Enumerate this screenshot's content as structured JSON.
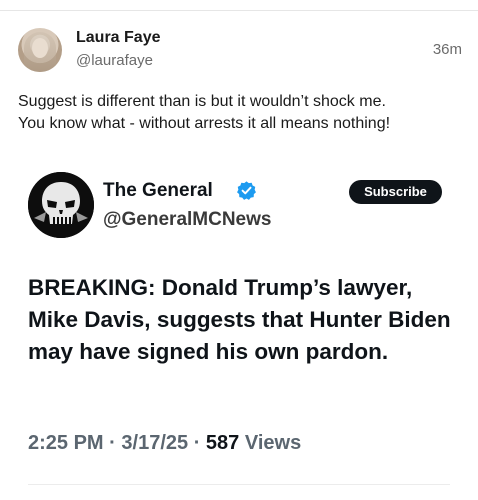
{
  "post": {
    "author_name": "Laura Faye",
    "author_handle": "@laurafaye",
    "time": "36m",
    "text": "Suggest is different than is but it wouldn’t shock me.\nYou know what - without arrests it all means nothing!"
  },
  "embedded_tweet": {
    "name": "The General",
    "handle": "@GeneralMCNews",
    "subscribe_label": "Subscribe",
    "headline": "BREAKING: Donald Trump’s lawyer, Mike Davis, suggests that Hunter Biden may have signed his own pardon.",
    "time": "2:25 PM",
    "date": "3/17/25",
    "views_count": "587",
    "views_label": "Views",
    "separator": "·"
  },
  "icons": {
    "verified": "verified-badge-icon",
    "avatar_logo": "punisher-skull-logo"
  },
  "colors": {
    "verified_blue": "#1d9bf0",
    "subscribe_bg": "#0f1419",
    "muted_text": "#6b6b6b"
  }
}
